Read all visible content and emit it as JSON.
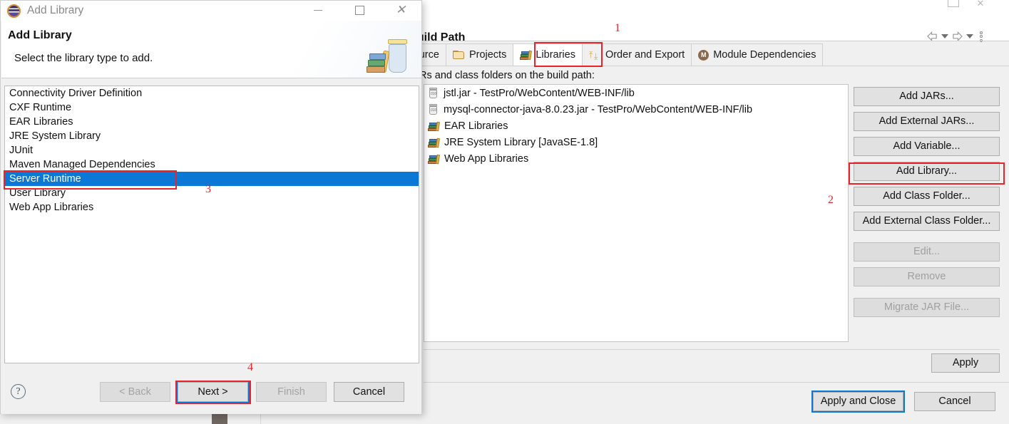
{
  "build_path_window": {
    "title": "a Build Path",
    "nav": {
      "back_icon": "arrow-left-icon",
      "back_menu_icon": "chevron-down-icon",
      "forward_icon": "arrow-right-icon",
      "forward_menu_icon": "chevron-down-icon",
      "overflow_icon": "vertical-dots-icon"
    },
    "window_controls": {
      "minimize_icon": "minimize-icon",
      "maximize_icon": "maximize-icon",
      "close_icon": "close-icon"
    },
    "tabs": [
      {
        "label": "Source",
        "icon": "",
        "selected": false
      },
      {
        "label": "Projects",
        "icon": "folder-icon",
        "selected": false
      },
      {
        "label": "Libraries",
        "icon": "books-icon",
        "selected": true
      },
      {
        "label": "Order and Export",
        "icon": "order-arrows-icon",
        "selected": false
      },
      {
        "label": "Module Dependencies",
        "icon": "module-icon",
        "selected": false
      }
    ],
    "list_caption": "Rs and class folders on the build path:",
    "jar_entries": [
      {
        "icon": "jar-icon",
        "label": "jstl.jar - TestPro/WebContent/WEB-INF/lib"
      },
      {
        "icon": "jar-icon",
        "label": "mysql-connector-java-8.0.23.jar - TestPro/WebContent/WEB-INF/lib"
      },
      {
        "icon": "books-icon",
        "label": "EAR Libraries"
      },
      {
        "icon": "books-icon",
        "label": "JRE System Library [JavaSE-1.8]"
      },
      {
        "icon": "books-icon",
        "label": "Web App Libraries"
      }
    ],
    "side_buttons": [
      {
        "label": "Add JARs...",
        "enabled": true,
        "highlighted": false
      },
      {
        "label": "Add External JARs...",
        "enabled": true,
        "highlighted": false
      },
      {
        "label": "Add Variable...",
        "enabled": true,
        "highlighted": false
      },
      {
        "label": "Add Library...",
        "enabled": true,
        "highlighted": true
      },
      {
        "label": "Add Class Folder...",
        "enabled": true,
        "highlighted": false
      },
      {
        "label": "Add External Class Folder...",
        "enabled": true,
        "highlighted": false
      },
      {
        "label": "Edit...",
        "enabled": false,
        "highlighted": false
      },
      {
        "label": "Remove",
        "enabled": false,
        "highlighted": false
      },
      {
        "label": "Migrate JAR File...",
        "enabled": false,
        "highlighted": false
      }
    ],
    "apply_label": "Apply",
    "apply_and_close_label": "Apply and Close",
    "cancel_label": "Cancel"
  },
  "add_library_dialog": {
    "title": "Add Library",
    "logo_icon": "eclipse-logo-icon",
    "window_controls": {
      "minimize_icon": "minimize-icon",
      "maximize_icon": "maximize-icon",
      "close_icon": "close-icon"
    },
    "heading": "Add Library",
    "subheading": "Select the library type to add.",
    "banner_icon": "jar-with-books-icon",
    "library_types": [
      {
        "label": "Connectivity Driver Definition",
        "selected": false
      },
      {
        "label": "CXF Runtime",
        "selected": false
      },
      {
        "label": "EAR Libraries",
        "selected": false
      },
      {
        "label": "JRE System Library",
        "selected": false
      },
      {
        "label": "JUnit",
        "selected": false
      },
      {
        "label": "Maven Managed Dependencies",
        "selected": false
      },
      {
        "label": "Server Runtime",
        "selected": true
      },
      {
        "label": "User Library",
        "selected": false
      },
      {
        "label": "Web App Libraries",
        "selected": false
      }
    ],
    "help_icon": "help-question-icon",
    "buttons": {
      "back": "< Back",
      "next": "Next >",
      "finish": "Finish",
      "cancel": "Cancel"
    }
  },
  "annotations": [
    {
      "number": "1"
    },
    {
      "number": "2"
    },
    {
      "number": "3"
    },
    {
      "number": "4"
    }
  ],
  "colors": {
    "selection_blue": "#0a78d4",
    "annotation_red": "#e8232a",
    "button_face": "#e1e1e1",
    "window_face": "#f0f0f0"
  }
}
